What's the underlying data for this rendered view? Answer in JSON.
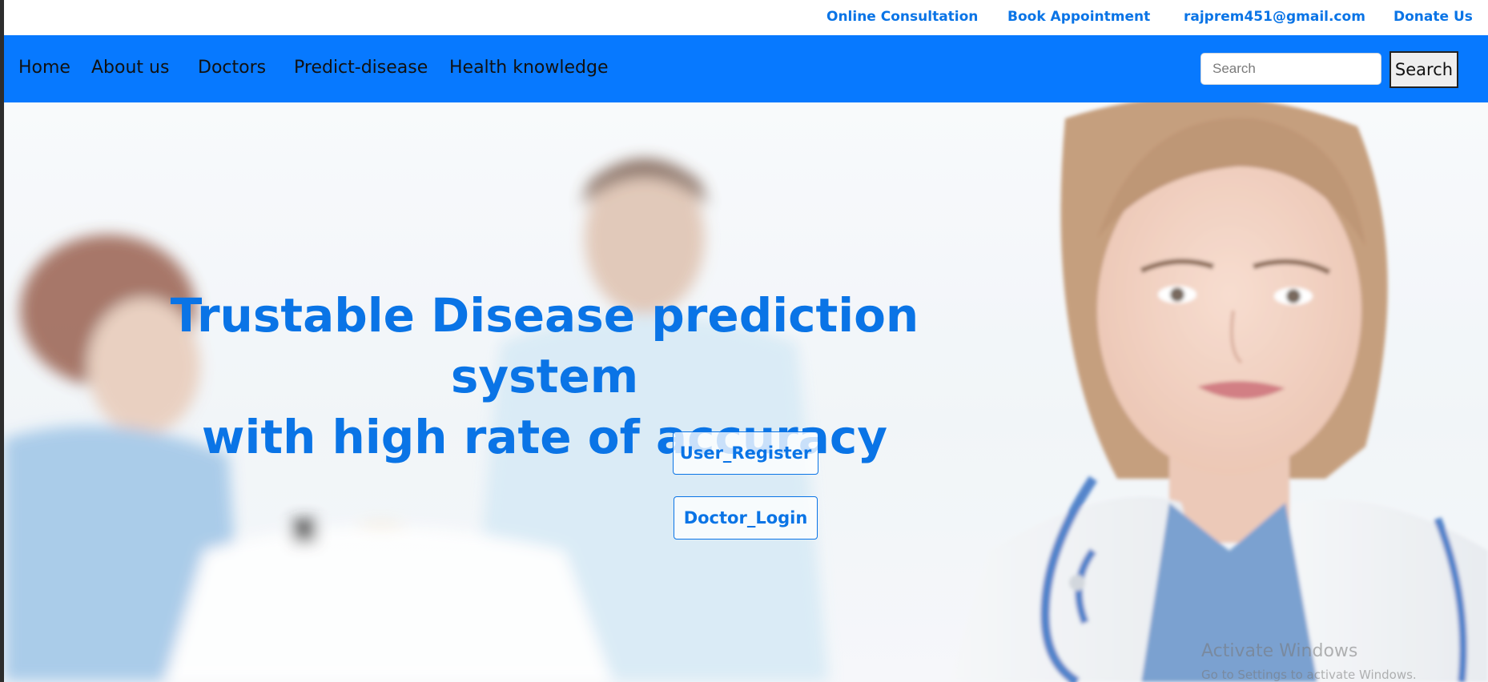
{
  "topbar": {
    "links": [
      {
        "label": "Online Consultation"
      },
      {
        "label": "Book Appointment"
      },
      {
        "label": "rajprem451@gmail.com"
      },
      {
        "label": "Donate Us"
      }
    ]
  },
  "nav": {
    "links": [
      {
        "label": "Home"
      },
      {
        "label": "About us"
      },
      {
        "label": "Doctors"
      },
      {
        "label": "Predict-disease"
      },
      {
        "label": "Health knowledge"
      }
    ],
    "search": {
      "placeholder": "Search",
      "button_label": "Search"
    }
  },
  "hero": {
    "title_line1": "Trustable Disease prediction system",
    "title_line2": "with high rate of accuracy",
    "user_register_label": "User_Register",
    "doctor_login_label": "Doctor_Login",
    "image_icon": "doctor-hero-photo"
  },
  "watermark": {
    "line1": "Activate Windows",
    "line2": "Go to Settings to activate Windows."
  },
  "colors": {
    "accent": "#0a74e6",
    "navbar": "#0779ff",
    "nav_text": "#111111"
  }
}
